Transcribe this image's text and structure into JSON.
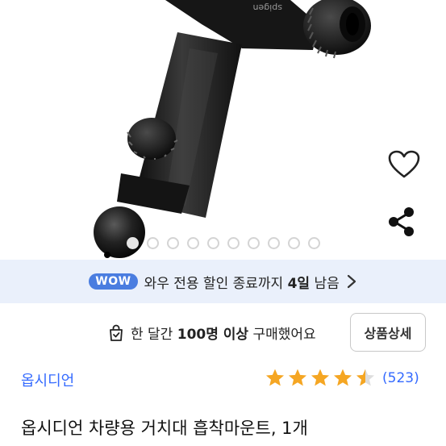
{
  "gallery": {
    "slide_count": 10,
    "active_index": 0,
    "product_logo_text": "spigen"
  },
  "wow": {
    "badge": "WOW",
    "text_pre": "와우 전용 할인 종료까지 ",
    "days": "4일",
    "text_post": " 남음"
  },
  "purchase": {
    "prefix": "한 달간 ",
    "count": "100명 이상",
    "suffix": " 구매했어요",
    "detail_button": "상품상세"
  },
  "product": {
    "brand": "옵시디언",
    "rating_value": 4.5,
    "review_count": "(523)",
    "title": "옵시디언 차량용 거치대 흡착마운트, 1개"
  },
  "colors": {
    "accent": "#346aff",
    "wow_badge": "#4a7de0",
    "wow_bg": "#eaf0fb",
    "star": "#f5a623"
  },
  "icons": {
    "like": "heart-icon",
    "share": "share-icon",
    "purchase": "shopping-bag-icon",
    "chevron": "chevron-right-icon"
  }
}
